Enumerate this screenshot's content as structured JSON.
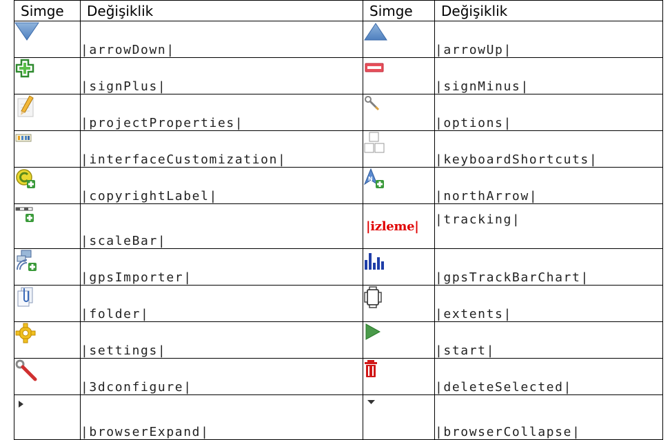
{
  "table": {
    "headers": [
      "Simge",
      "Değişiklik",
      "Simge",
      "Değişiklik"
    ],
    "rows": [
      {
        "left_icon": "arrow-down-icon",
        "left_code": "|arrowDown|",
        "right_icon": "arrow-up-icon",
        "right_code": "|arrowUp|"
      },
      {
        "left_icon": "sign-plus-icon",
        "left_code": "|signPlus|",
        "right_icon": "sign-minus-icon",
        "right_code": "|signMinus|"
      },
      {
        "left_icon": "project-properties-icon",
        "left_code": "|projectProperties|",
        "right_icon": "options-icon",
        "right_code": "|options|"
      },
      {
        "left_icon": "interface-customization-icon",
        "left_code": "|interfaceCustomization|",
        "right_icon": "keyboard-shortcuts-icon",
        "right_code": "|keyboardShortcuts|"
      },
      {
        "left_icon": "copyright-label-icon",
        "left_code": "|copyrightLabel|",
        "right_icon": "north-arrow-icon",
        "right_code": "|northArrow|"
      },
      {
        "left_icon": "scale-bar-icon",
        "left_code": "|scaleBar|",
        "right_label": "|izleme|",
        "right_code": "|tracking|"
      },
      {
        "left_icon": "gps-importer-icon",
        "left_code": "|gpsImporter|",
        "right_icon": "gps-track-bar-chart-icon",
        "right_code": "|gpsTrackBarChart|"
      },
      {
        "left_icon": "folder-icon",
        "left_code": "|folder|",
        "right_icon": "extents-icon",
        "right_code": "|extents|"
      },
      {
        "left_icon": "settings-icon",
        "left_code": "|settings|",
        "right_icon": "start-icon",
        "right_code": "|start|"
      },
      {
        "left_icon": "3d-configure-icon",
        "left_code": "|3dconfigure|",
        "right_icon": "delete-selected-icon",
        "right_code": "|deleteSelected|"
      },
      {
        "left_icon": "browser-expand-icon",
        "left_code": "|browserExpand|",
        "right_icon": "browser-collapse-icon",
        "right_code": "|browserCollapse|"
      }
    ]
  }
}
